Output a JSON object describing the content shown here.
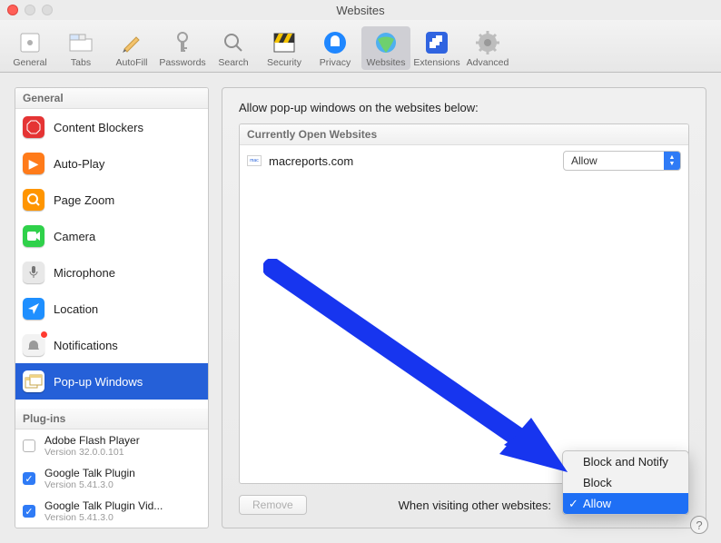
{
  "window": {
    "title": "Websites"
  },
  "toolbar": {
    "items": [
      {
        "label": "General"
      },
      {
        "label": "Tabs"
      },
      {
        "label": "AutoFill"
      },
      {
        "label": "Passwords"
      },
      {
        "label": "Search"
      },
      {
        "label": "Security"
      },
      {
        "label": "Privacy"
      },
      {
        "label": "Websites",
        "selected": true
      },
      {
        "label": "Extensions"
      },
      {
        "label": "Advanced"
      }
    ]
  },
  "sidebar": {
    "general_header": "General",
    "items": [
      {
        "label": "Content Blockers"
      },
      {
        "label": "Auto-Play"
      },
      {
        "label": "Page Zoom"
      },
      {
        "label": "Camera"
      },
      {
        "label": "Microphone"
      },
      {
        "label": "Location"
      },
      {
        "label": "Notifications"
      },
      {
        "label": "Pop-up Windows",
        "selected": true
      }
    ],
    "plugins_header": "Plug-ins",
    "plugins": [
      {
        "name": "Adobe Flash Player",
        "version": "Version 32.0.0.101",
        "checked": false
      },
      {
        "name": "Google Talk Plugin",
        "version": "Version 5.41.3.0",
        "checked": true
      },
      {
        "name": "Google Talk Plugin Vid...",
        "version": "Version 5.41.3.0",
        "checked": true
      }
    ]
  },
  "main": {
    "header": "Allow pop-up windows on the websites below:",
    "table_header": "Currently Open Websites",
    "rows": [
      {
        "site": "macreports.com",
        "value": "Allow"
      }
    ],
    "remove_label": "Remove",
    "footer_label": "When visiting other websites:",
    "footer_value": "Allow",
    "menu_options": [
      "Block and Notify",
      "Block",
      "Allow"
    ],
    "menu_selected": "Allow"
  }
}
